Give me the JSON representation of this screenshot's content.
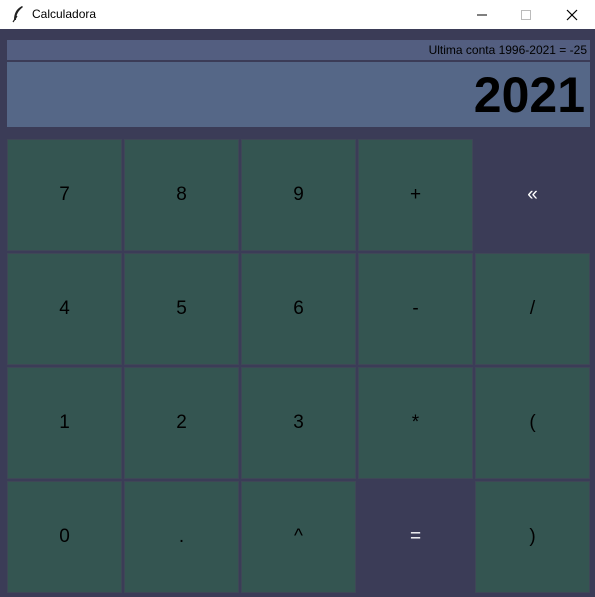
{
  "window": {
    "title": "Calculadora"
  },
  "last_calc": "Ultima conta 1996-2021 = -25",
  "display": "2021",
  "keys": {
    "k7": "7",
    "k8": "8",
    "k9": "9",
    "plus": "+",
    "back": "«",
    "k4": "4",
    "k5": "5",
    "k6": "6",
    "minus": "-",
    "div": "/",
    "k1": "1",
    "k2": "2",
    "k3": "3",
    "mul": "*",
    "lparen": "(",
    "k0": "0",
    "dot": ".",
    "pow": "^",
    "eq": "=",
    "rparen": ")"
  },
  "colors": {
    "background": "#3b3c57",
    "key": "#345551",
    "display": "#556787",
    "last_bar": "#535e80"
  },
  "icons": {
    "app": "feather-icon",
    "minimize": "minimize-icon",
    "maximize": "maximize-icon",
    "close": "close-icon"
  }
}
